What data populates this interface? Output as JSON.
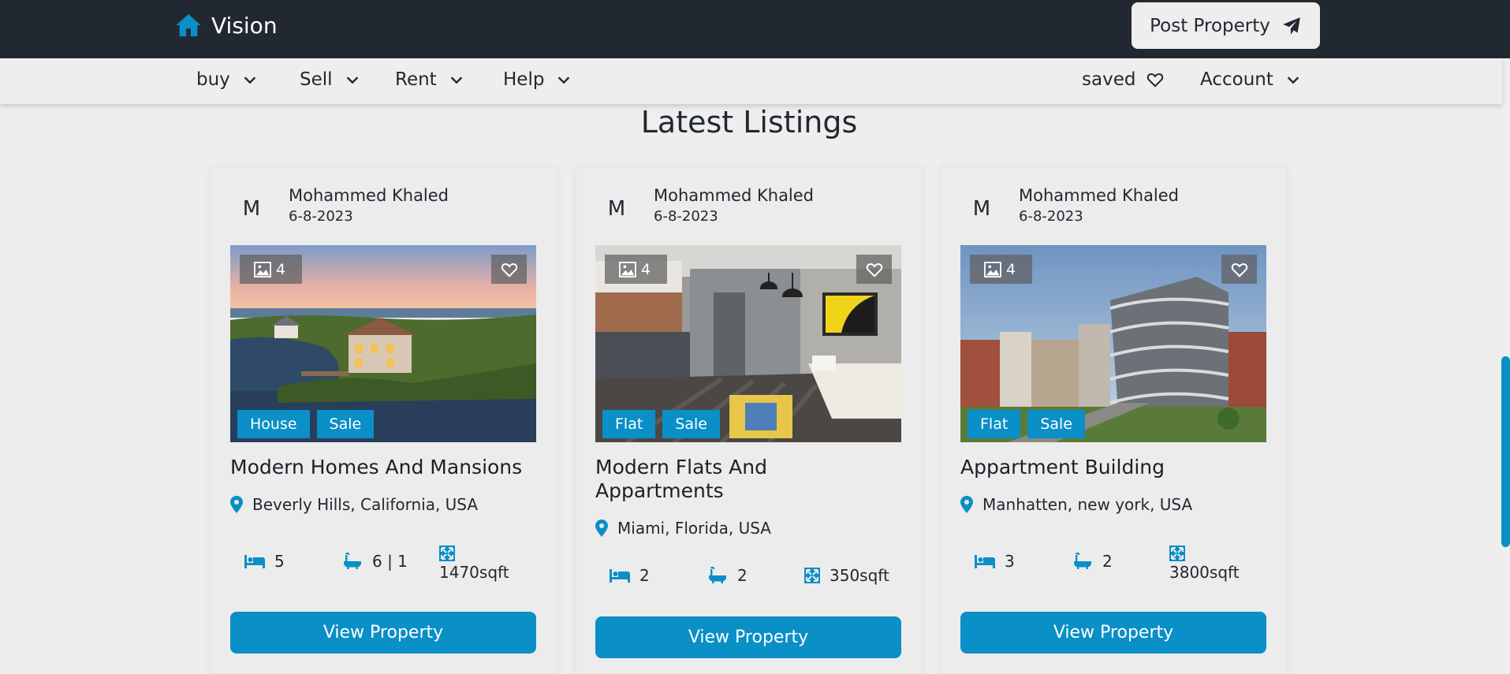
{
  "header": {
    "brand_name": "Vision",
    "brand_icon": "home-icon",
    "post_label": "Post Property",
    "post_icon": "paper-plane-icon",
    "accent_color": "#0a8fc7",
    "bar_color": "#222831"
  },
  "nav": {
    "buy": "buy",
    "sell": "Sell",
    "rent": "Rent",
    "help": "Help",
    "saved": "saved",
    "account": "Account"
  },
  "section": {
    "title": "Latest Listings"
  },
  "listings": [
    {
      "avatar": "M",
      "author": "Mohammed Khaled",
      "date": "6-8-2023",
      "photo_count": "4",
      "type": "House",
      "status": "Sale",
      "title": "Modern Homes And Mansions",
      "location": "Beverly Hills, California, USA",
      "beds": "5",
      "baths": "6 | 1",
      "area": "1470sqft",
      "button": "View Property"
    },
    {
      "avatar": "M",
      "author": "Mohammed Khaled",
      "date": "6-8-2023",
      "photo_count": "4",
      "type": "Flat",
      "status": "Sale",
      "title": "Modern Flats And Appartments",
      "location": "Miami, Florida, USA",
      "beds": "2",
      "baths": "2",
      "area": "350sqft",
      "button": "View Property"
    },
    {
      "avatar": "M",
      "author": "Mohammed Khaled",
      "date": "6-8-2023",
      "photo_count": "4",
      "type": "Flat",
      "status": "Sale",
      "title": "Appartment Building",
      "location": "Manhatten, new york, USA",
      "beds": "3",
      "baths": "2",
      "area": "3800sqft",
      "button": "View Property"
    }
  ]
}
